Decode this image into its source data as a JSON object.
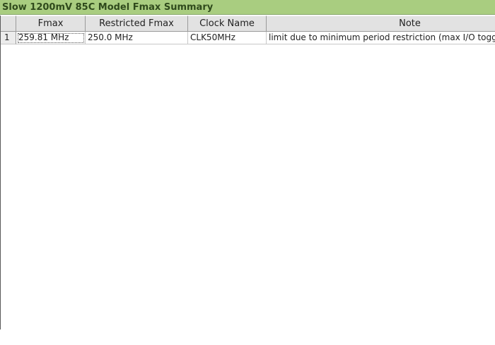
{
  "panel": {
    "title": "Slow 1200mV 85C Model Fmax Summary"
  },
  "table": {
    "columns": [
      "Fmax",
      "Restricted Fmax",
      "Clock Name",
      "Note"
    ],
    "rows": [
      {
        "index": "1",
        "fmax": "259.81 MHz",
        "restricted_fmax": "250.0 MHz",
        "clock_name": "CLK50MHz",
        "note": "limit due to minimum period restriction (max I/O toggle rate)"
      }
    ]
  },
  "scrollbar": {
    "left_arrow": "◀",
    "right_arrow": "▶"
  },
  "colors": {
    "title_bar": "#a9cd80",
    "title_text": "#2f4a1c",
    "header_bg": "#e2e2e2"
  }
}
